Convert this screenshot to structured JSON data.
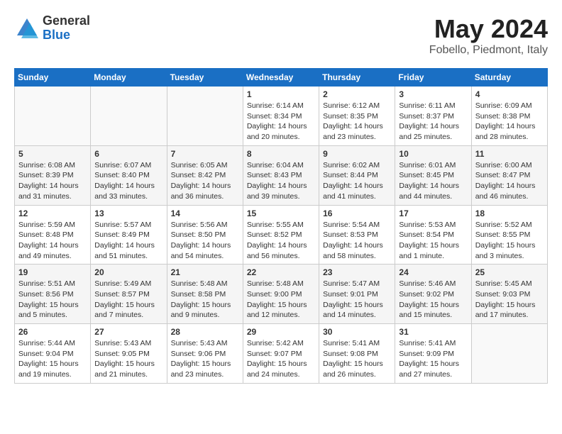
{
  "logo": {
    "general": "General",
    "blue": "Blue"
  },
  "title": {
    "month_year": "May 2024",
    "location": "Fobello, Piedmont, Italy"
  },
  "weekdays": [
    "Sunday",
    "Monday",
    "Tuesday",
    "Wednesday",
    "Thursday",
    "Friday",
    "Saturday"
  ],
  "weeks": [
    [
      {
        "day": "",
        "empty": true
      },
      {
        "day": "",
        "empty": true
      },
      {
        "day": "",
        "empty": true
      },
      {
        "day": "1",
        "sunrise": "6:14 AM",
        "sunset": "8:34 PM",
        "daylight": "14 hours and 20 minutes."
      },
      {
        "day": "2",
        "sunrise": "6:12 AM",
        "sunset": "8:35 PM",
        "daylight": "14 hours and 23 minutes."
      },
      {
        "day": "3",
        "sunrise": "6:11 AM",
        "sunset": "8:37 PM",
        "daylight": "14 hours and 25 minutes."
      },
      {
        "day": "4",
        "sunrise": "6:09 AM",
        "sunset": "8:38 PM",
        "daylight": "14 hours and 28 minutes."
      }
    ],
    [
      {
        "day": "5",
        "sunrise": "6:08 AM",
        "sunset": "8:39 PM",
        "daylight": "14 hours and 31 minutes."
      },
      {
        "day": "6",
        "sunrise": "6:07 AM",
        "sunset": "8:40 PM",
        "daylight": "14 hours and 33 minutes."
      },
      {
        "day": "7",
        "sunrise": "6:05 AM",
        "sunset": "8:42 PM",
        "daylight": "14 hours and 36 minutes."
      },
      {
        "day": "8",
        "sunrise": "6:04 AM",
        "sunset": "8:43 PM",
        "daylight": "14 hours and 39 minutes."
      },
      {
        "day": "9",
        "sunrise": "6:02 AM",
        "sunset": "8:44 PM",
        "daylight": "14 hours and 41 minutes."
      },
      {
        "day": "10",
        "sunrise": "6:01 AM",
        "sunset": "8:45 PM",
        "daylight": "14 hours and 44 minutes."
      },
      {
        "day": "11",
        "sunrise": "6:00 AM",
        "sunset": "8:47 PM",
        "daylight": "14 hours and 46 minutes."
      }
    ],
    [
      {
        "day": "12",
        "sunrise": "5:59 AM",
        "sunset": "8:48 PM",
        "daylight": "14 hours and 49 minutes."
      },
      {
        "day": "13",
        "sunrise": "5:57 AM",
        "sunset": "8:49 PM",
        "daylight": "14 hours and 51 minutes."
      },
      {
        "day": "14",
        "sunrise": "5:56 AM",
        "sunset": "8:50 PM",
        "daylight": "14 hours and 54 minutes."
      },
      {
        "day": "15",
        "sunrise": "5:55 AM",
        "sunset": "8:52 PM",
        "daylight": "14 hours and 56 minutes."
      },
      {
        "day": "16",
        "sunrise": "5:54 AM",
        "sunset": "8:53 PM",
        "daylight": "14 hours and 58 minutes."
      },
      {
        "day": "17",
        "sunrise": "5:53 AM",
        "sunset": "8:54 PM",
        "daylight": "15 hours and 1 minute."
      },
      {
        "day": "18",
        "sunrise": "5:52 AM",
        "sunset": "8:55 PM",
        "daylight": "15 hours and 3 minutes."
      }
    ],
    [
      {
        "day": "19",
        "sunrise": "5:51 AM",
        "sunset": "8:56 PM",
        "daylight": "15 hours and 5 minutes."
      },
      {
        "day": "20",
        "sunrise": "5:49 AM",
        "sunset": "8:57 PM",
        "daylight": "15 hours and 7 minutes."
      },
      {
        "day": "21",
        "sunrise": "5:48 AM",
        "sunset": "8:58 PM",
        "daylight": "15 hours and 9 minutes."
      },
      {
        "day": "22",
        "sunrise": "5:48 AM",
        "sunset": "9:00 PM",
        "daylight": "15 hours and 12 minutes."
      },
      {
        "day": "23",
        "sunrise": "5:47 AM",
        "sunset": "9:01 PM",
        "daylight": "15 hours and 14 minutes."
      },
      {
        "day": "24",
        "sunrise": "5:46 AM",
        "sunset": "9:02 PM",
        "daylight": "15 hours and 15 minutes."
      },
      {
        "day": "25",
        "sunrise": "5:45 AM",
        "sunset": "9:03 PM",
        "daylight": "15 hours and 17 minutes."
      }
    ],
    [
      {
        "day": "26",
        "sunrise": "5:44 AM",
        "sunset": "9:04 PM",
        "daylight": "15 hours and 19 minutes."
      },
      {
        "day": "27",
        "sunrise": "5:43 AM",
        "sunset": "9:05 PM",
        "daylight": "15 hours and 21 minutes."
      },
      {
        "day": "28",
        "sunrise": "5:43 AM",
        "sunset": "9:06 PM",
        "daylight": "15 hours and 23 minutes."
      },
      {
        "day": "29",
        "sunrise": "5:42 AM",
        "sunset": "9:07 PM",
        "daylight": "15 hours and 24 minutes."
      },
      {
        "day": "30",
        "sunrise": "5:41 AM",
        "sunset": "9:08 PM",
        "daylight": "15 hours and 26 minutes."
      },
      {
        "day": "31",
        "sunrise": "5:41 AM",
        "sunset": "9:09 PM",
        "daylight": "15 hours and 27 minutes."
      },
      {
        "day": "",
        "empty": true
      }
    ]
  ]
}
